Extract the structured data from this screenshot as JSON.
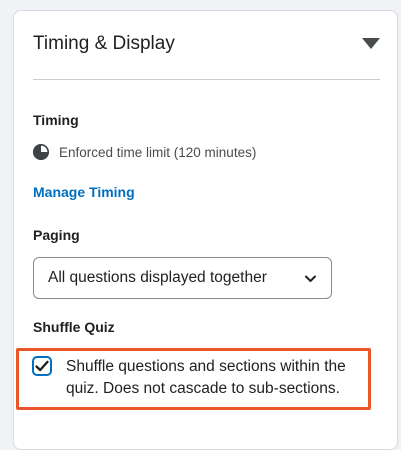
{
  "panel": {
    "title": "Timing & Display",
    "collapse_icon": "caret-down-icon"
  },
  "timing": {
    "heading": "Timing",
    "icon": "clock-icon",
    "limit_text": "Enforced time limit (120 minutes)",
    "manage_link": "Manage Timing"
  },
  "paging": {
    "heading": "Paging",
    "selected": "All questions displayed together",
    "chevron_icon": "chevron-down-icon"
  },
  "shuffle": {
    "heading": "Shuffle Quiz",
    "checked": true,
    "label": "Shuffle questions and sections within the quiz. Does not cascade to sub-sections."
  },
  "colors": {
    "link": "#006fbf",
    "checkbox": "#006fbf",
    "highlight": "#e8562a",
    "text": "#202122",
    "muted_text": "#494c4e",
    "page_background": "#f1f2f5"
  }
}
